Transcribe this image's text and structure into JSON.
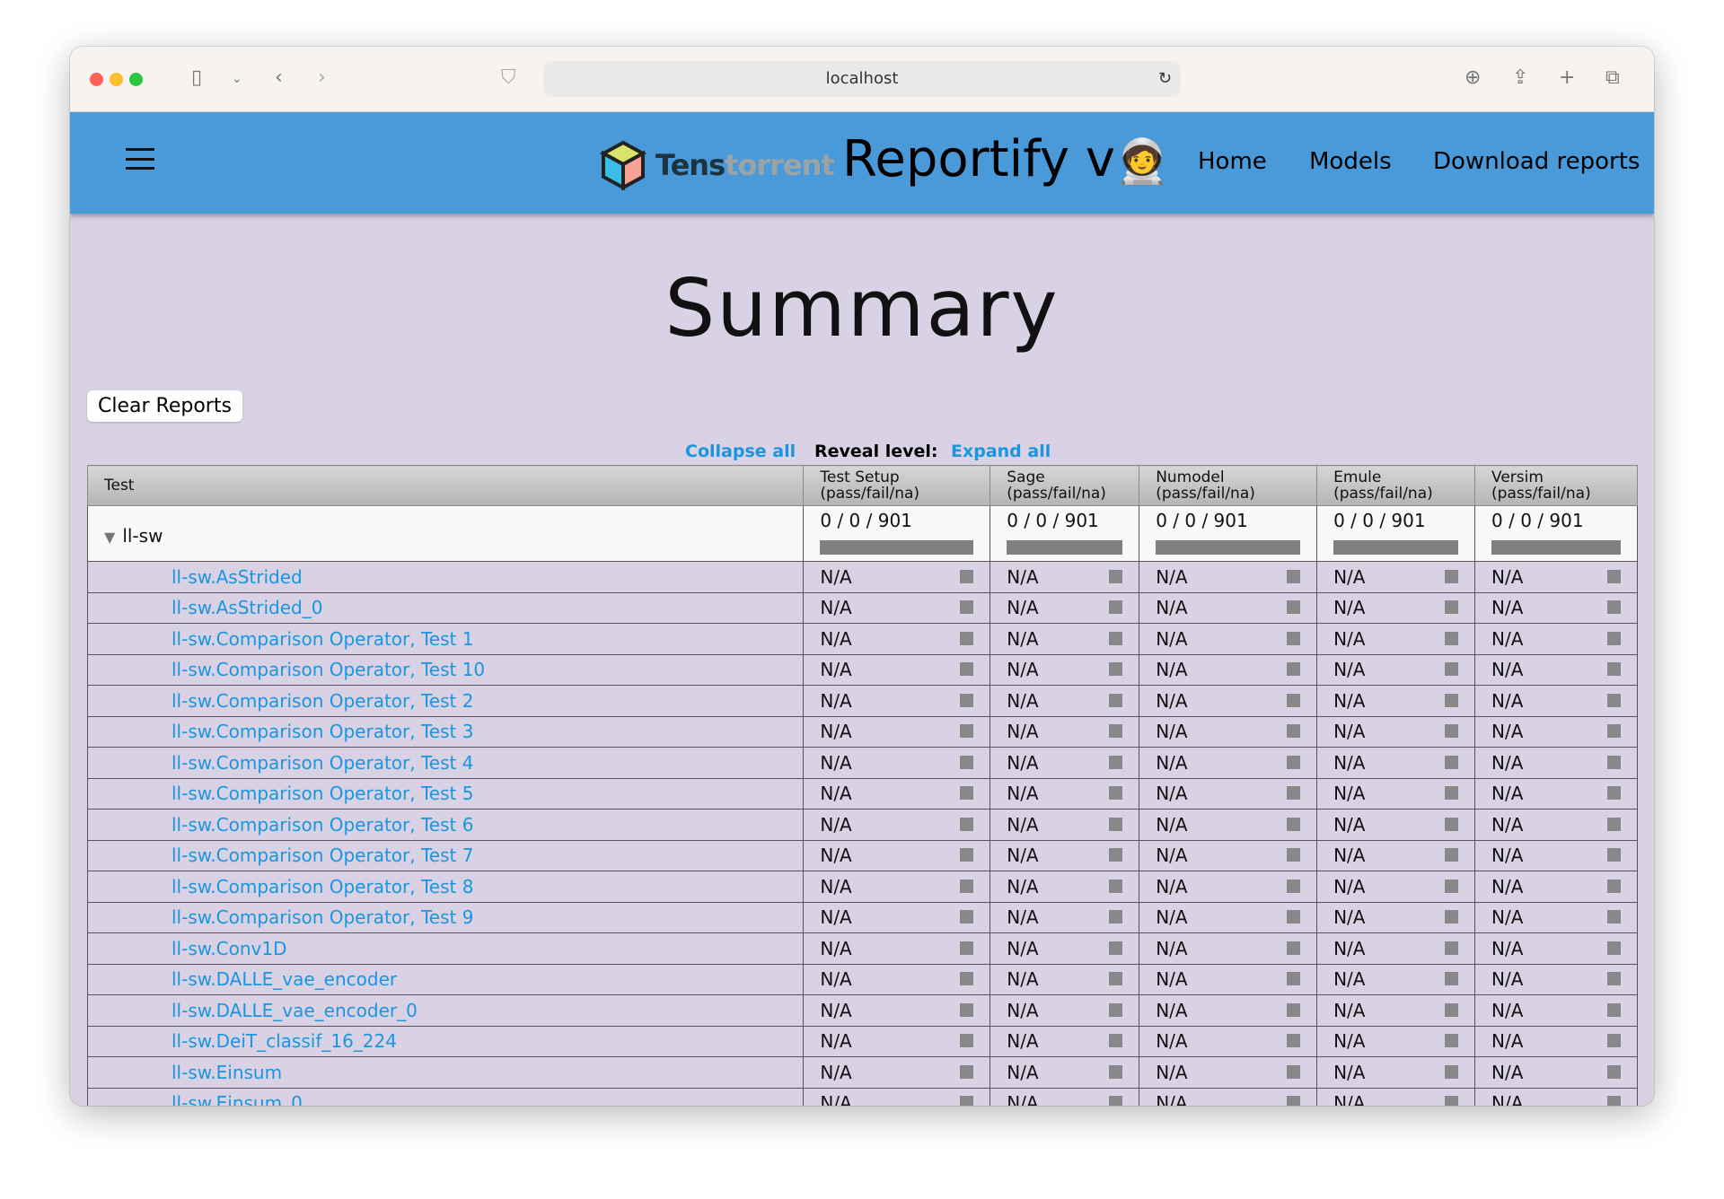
{
  "browser": {
    "url": "localhost"
  },
  "header": {
    "logo_a": "Tens",
    "logo_b": "torrent",
    "title": "Reportify v",
    "title_emoji": "🧑‍🚀",
    "nav": [
      "Home",
      "Models",
      "Download reports"
    ]
  },
  "page": {
    "title": "Summary",
    "clear_button": "Clear Reports",
    "collapse_all": "Collapse all",
    "reveal_level": "Reveal level:",
    "expand_all": "Expand all"
  },
  "table": {
    "columns": [
      {
        "name": "Test",
        "sub": ""
      },
      {
        "name": "Test Setup",
        "sub": "(pass/fail/na)"
      },
      {
        "name": "Sage",
        "sub": "(pass/fail/na)"
      },
      {
        "name": "Numodel",
        "sub": "(pass/fail/na)"
      },
      {
        "name": "Emule",
        "sub": "(pass/fail/na)"
      },
      {
        "name": "Versim",
        "sub": "(pass/fail/na)"
      }
    ],
    "group": {
      "name": "ll-sw",
      "values": [
        "0 / 0 / 901",
        "0 / 0 / 901",
        "0 / 0 / 901",
        "0 / 0 / 901",
        "0 / 0 / 901"
      ]
    },
    "cell_value": "N/A",
    "rows": [
      "ll-sw.AsStrided",
      "ll-sw.AsStrided_0",
      "ll-sw.Comparison Operator, Test 1",
      "ll-sw.Comparison Operator, Test 10",
      "ll-sw.Comparison Operator, Test 2",
      "ll-sw.Comparison Operator, Test 3",
      "ll-sw.Comparison Operator, Test 4",
      "ll-sw.Comparison Operator, Test 5",
      "ll-sw.Comparison Operator, Test 6",
      "ll-sw.Comparison Operator, Test 7",
      "ll-sw.Comparison Operator, Test 8",
      "ll-sw.Comparison Operator, Test 9",
      "ll-sw.Conv1D",
      "ll-sw.DALLE_vae_encoder",
      "ll-sw.DALLE_vae_encoder_0",
      "ll-sw.DeiT_classif_16_224",
      "ll-sw.Einsum",
      "ll-sw.Einsum_0"
    ]
  }
}
